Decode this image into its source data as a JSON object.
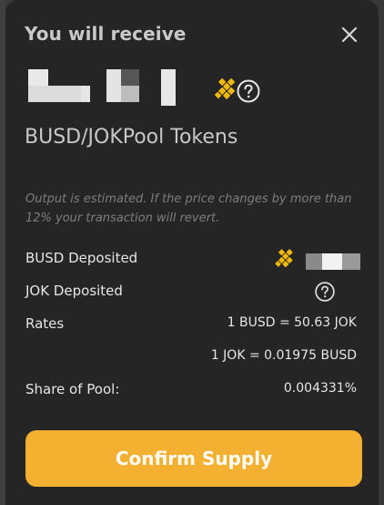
{
  "modal": {
    "title": "You will receive",
    "close_icon": "close-icon"
  },
  "receive": {
    "token_name": "BUSD/JOKPool Tokens",
    "token_logo_icon": "busd-logo-icon",
    "help_icon": "question-circle-icon"
  },
  "note": "Output is estimated. If the price changes by more than 12% your transaction will revert.",
  "details": {
    "busd_deposited_label": "BUSD Deposited",
    "jok_deposited_label": "JOK Deposited",
    "rates_label": "Rates",
    "rate_busd": "1 BUSD = 50.63 JOK",
    "rate_jok": "1 JOK = 0.01975 BUSD",
    "share_label": "Share of Pool:",
    "share_value": "0.004331%"
  },
  "actions": {
    "confirm_label": "Confirm Supply"
  },
  "colors": {
    "accent": "#f4b030",
    "busd_logo": "#f0b90b",
    "modal_bg": "#252525"
  }
}
